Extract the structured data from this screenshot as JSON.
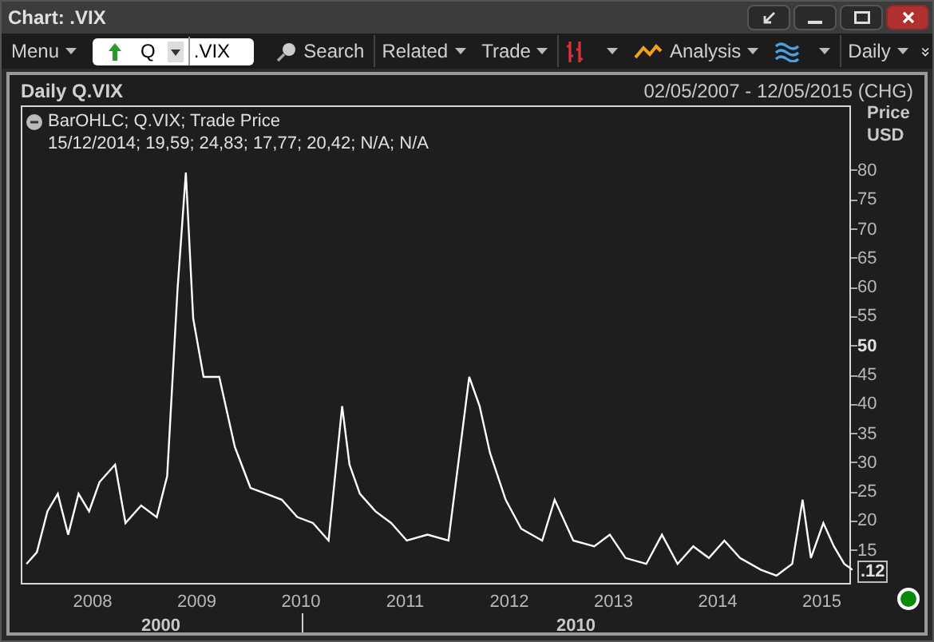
{
  "window": {
    "title": "Chart: .VIX"
  },
  "toolbar": {
    "menu": "Menu",
    "instrument_prefix": "Q",
    "symbol": ".VIX",
    "search": "Search",
    "related": "Related",
    "trade": "Trade",
    "analysis": "Analysis",
    "interval": "Daily"
  },
  "chart": {
    "title": "Daily Q.VIX",
    "date_range": "02/05/2007 - 12/05/2015 (CHG)",
    "legend": [
      "BarOHLC; Q.VIX; Trade Price",
      "15/12/2014; 19,59; 24,83; 17,77; 20,42; N/A; N/A"
    ],
    "axis_title": [
      "Price",
      "USD"
    ],
    "last_value": ".12",
    "eras": [
      {
        "label": "2000"
      },
      {
        "label": "2010"
      }
    ],
    "chart_data": {
      "type": "line",
      "xlim": [
        2007.31,
        2015.28
      ],
      "ylim": [
        9.2,
        91.2
      ],
      "xticks": [
        2008,
        2009,
        2010,
        2011,
        2012,
        2013,
        2014,
        2015
      ],
      "yticks": [
        15,
        20,
        25,
        30,
        35,
        40,
        45,
        50,
        55,
        60,
        65,
        70,
        75,
        80
      ],
      "x": [
        2007.35,
        2007.45,
        2007.55,
        2007.65,
        2007.75,
        2007.85,
        2007.95,
        2008.05,
        2008.2,
        2008.3,
        2008.45,
        2008.6,
        2008.7,
        2008.8,
        2008.88,
        2008.95,
        2009.05,
        2009.2,
        2009.35,
        2009.5,
        2009.65,
        2009.8,
        2009.95,
        2010.1,
        2010.25,
        2010.38,
        2010.45,
        2010.55,
        2010.7,
        2010.85,
        2011.0,
        2011.2,
        2011.4,
        2011.6,
        2011.7,
        2011.8,
        2011.95,
        2012.1,
        2012.3,
        2012.42,
        2012.6,
        2012.8,
        2012.95,
        2013.1,
        2013.3,
        2013.45,
        2013.6,
        2013.75,
        2013.9,
        2014.05,
        2014.2,
        2014.4,
        2014.55,
        2014.7,
        2014.8,
        2014.88,
        2015.0,
        2015.1,
        2015.2,
        2015.28
      ],
      "series": [
        {
          "color": "#ffffff",
          "values": [
            13,
            15,
            22,
            25,
            18,
            25,
            22,
            27,
            30,
            20,
            23,
            21,
            28,
            60,
            80,
            55,
            45,
            45,
            33,
            26,
            25,
            24,
            21,
            20,
            17,
            40,
            30,
            25,
            22,
            20,
            17,
            18,
            17,
            45,
            40,
            32,
            24,
            19,
            17,
            24,
            17,
            16,
            18,
            14,
            13,
            18,
            13,
            16,
            14,
            17,
            14,
            12,
            11,
            13,
            24,
            14,
            20,
            16,
            13,
            12
          ]
        }
      ]
    }
  },
  "status": {
    "on": true
  }
}
